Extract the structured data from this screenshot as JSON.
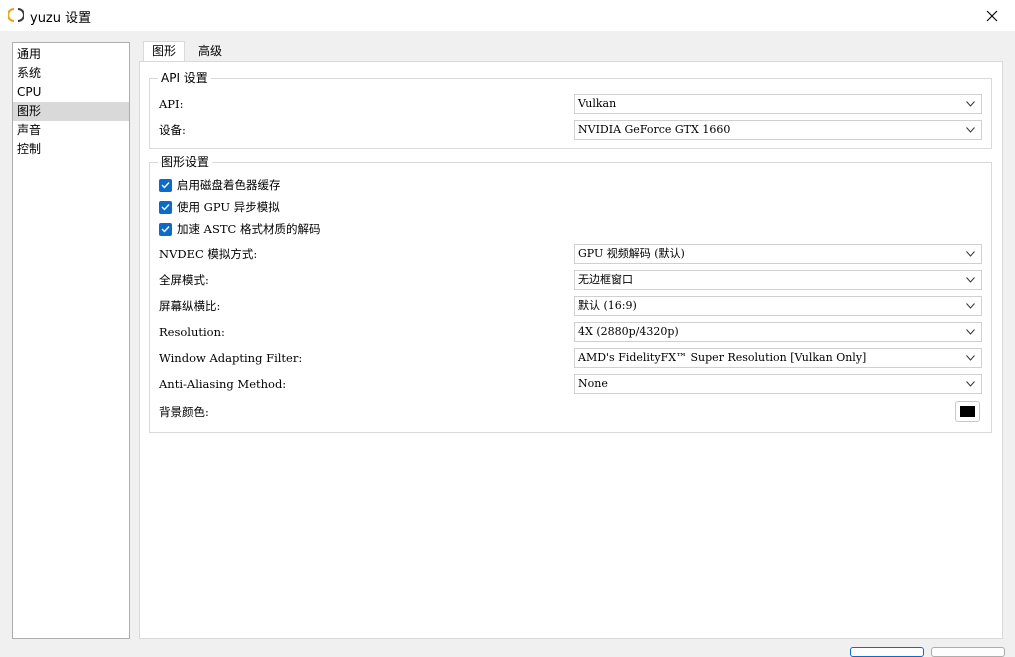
{
  "window": {
    "title": "yuzu 设置"
  },
  "sidebar": {
    "items": [
      {
        "label": "通用"
      },
      {
        "label": "系统"
      },
      {
        "label": "CPU"
      },
      {
        "label": "图形",
        "selected": true
      },
      {
        "label": "声音"
      },
      {
        "label": "控制"
      }
    ]
  },
  "tabs": [
    {
      "label": "图形",
      "active": true
    },
    {
      "label": "高级"
    }
  ],
  "api_group": {
    "title": "API 设置",
    "api_label": "API:",
    "api_value": "Vulkan",
    "device_label": "设备:",
    "device_value": "NVIDIA GeForce GTX 1660"
  },
  "graphics_group": {
    "title": "图形设置",
    "checkboxes": [
      {
        "label": "启用磁盘着色器缓存",
        "checked": true
      },
      {
        "label": "使用 GPU 异步模拟",
        "checked": true
      },
      {
        "label": "加速 ASTC 格式材质的解码",
        "checked": true
      }
    ],
    "nvdec_label": "NVDEC 模拟方式:",
    "nvdec_value": "GPU 视频解码 (默认)",
    "fullscreen_label": "全屏模式:",
    "fullscreen_value": "无边框窗口",
    "aspect_label": "屏幕纵横比:",
    "aspect_value": "默认 (16:9)",
    "resolution_label": "Resolution:",
    "resolution_value": "4X (2880p/4320p)",
    "filter_label": "Window Adapting Filter:",
    "filter_value": "AMD's FidelityFX™ Super Resolution [Vulkan Only]",
    "aa_label": "Anti-Aliasing Method:",
    "aa_value": "None",
    "bg_label": "背景颜色:",
    "bg_color": "#000000"
  },
  "colors": {
    "accent": "#0b6bcb",
    "selected_item": "#d9d9d9"
  }
}
